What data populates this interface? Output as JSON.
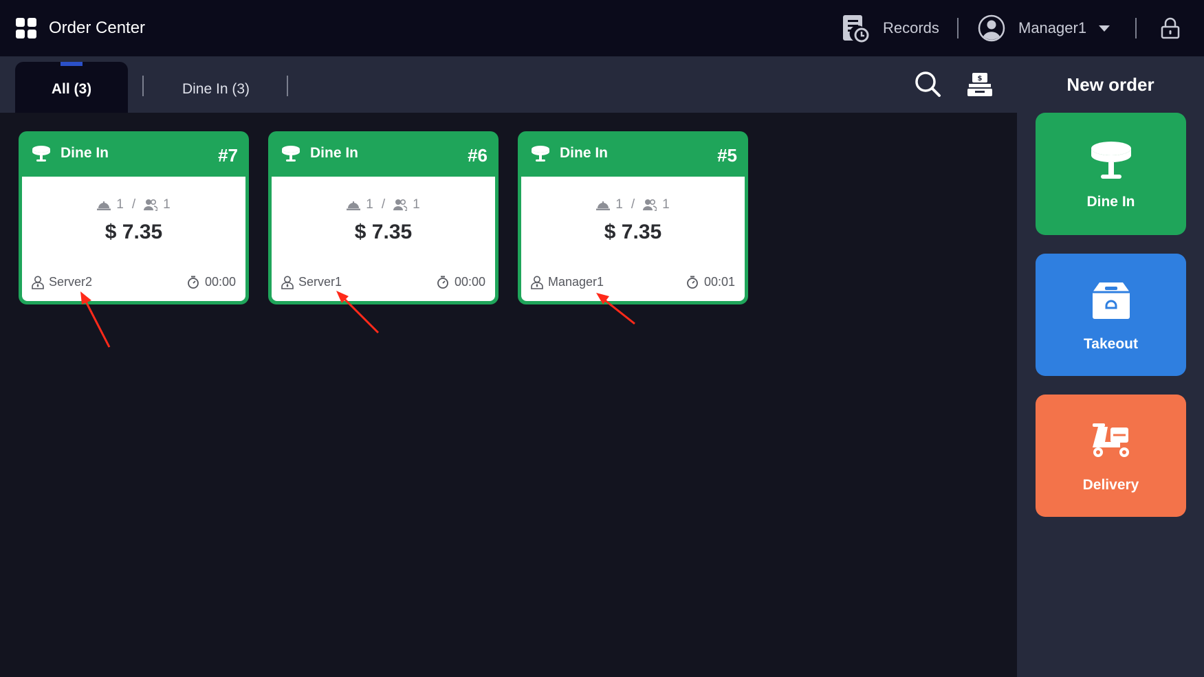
{
  "header": {
    "title": "Order Center",
    "records_label": "Records",
    "user_name": "Manager1"
  },
  "tabs": [
    {
      "label": "All (3)",
      "active": true
    },
    {
      "label": "Dine In (3)",
      "active": false
    }
  ],
  "orders": [
    {
      "type": "Dine In",
      "number": "#7",
      "dishes": "1",
      "guests": "1",
      "price": "$ 7.35",
      "server": "Server2",
      "elapsed": "00:00"
    },
    {
      "type": "Dine In",
      "number": "#6",
      "dishes": "1",
      "guests": "1",
      "price": "$ 7.35",
      "server": "Server1",
      "elapsed": "00:00"
    },
    {
      "type": "Dine In",
      "number": "#5",
      "dishes": "1",
      "guests": "1",
      "price": "$ 7.35",
      "server": "Manager1",
      "elapsed": "00:01"
    }
  ],
  "stats_separator": "/",
  "new_order": {
    "title": "New order",
    "buttons": [
      {
        "label": "Dine In",
        "color": "#1fa55a",
        "icon": "table-icon"
      },
      {
        "label": "Takeout",
        "color": "#2f7fe0",
        "icon": "takeout-box-icon"
      },
      {
        "label": "Delivery",
        "color": "#f3734a",
        "icon": "delivery-scooter-icon"
      }
    ]
  },
  "colors": {
    "topbar": "#0b0b1b",
    "tabbar": "#262a3c",
    "background": "#13141f",
    "dine_in_green": "#1fa55a",
    "active_tab_indicator": "#2b50c8",
    "annotation_red": "#ff2a1a"
  }
}
